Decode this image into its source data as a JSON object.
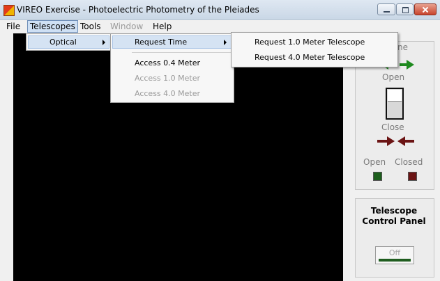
{
  "window": {
    "title": "VIREO Exercise - Photoelectric Photometry of the Pleiades"
  },
  "menubar": {
    "items": [
      "File",
      "Telescopes",
      "Tools",
      "Window",
      "Help"
    ]
  },
  "telescopes_menu": {
    "optical_label": "Optical"
  },
  "optical_submenu": {
    "request_time": "Request Time",
    "access_04": "Access 0.4 Meter",
    "access_10": "Access 1.0 Meter",
    "access_40": "Access 4.0 Meter"
  },
  "request_submenu": {
    "items": [
      "Request 1.0 Meter Telescope",
      "Request 4.0 Meter Telescope"
    ]
  },
  "dome_panel": {
    "title_partial": "ne",
    "open_label": "Open",
    "close_label": "Close",
    "open_status_label": "Open",
    "closed_status_label": "Closed"
  },
  "telescope_panel": {
    "title_line1": "Telescope",
    "title_line2": "Control Panel",
    "off_button": "Off"
  },
  "colors": {
    "open_green": "#1f8a1f",
    "closed_red": "#6b1414",
    "menu_highlight": "#d5e3f3"
  }
}
